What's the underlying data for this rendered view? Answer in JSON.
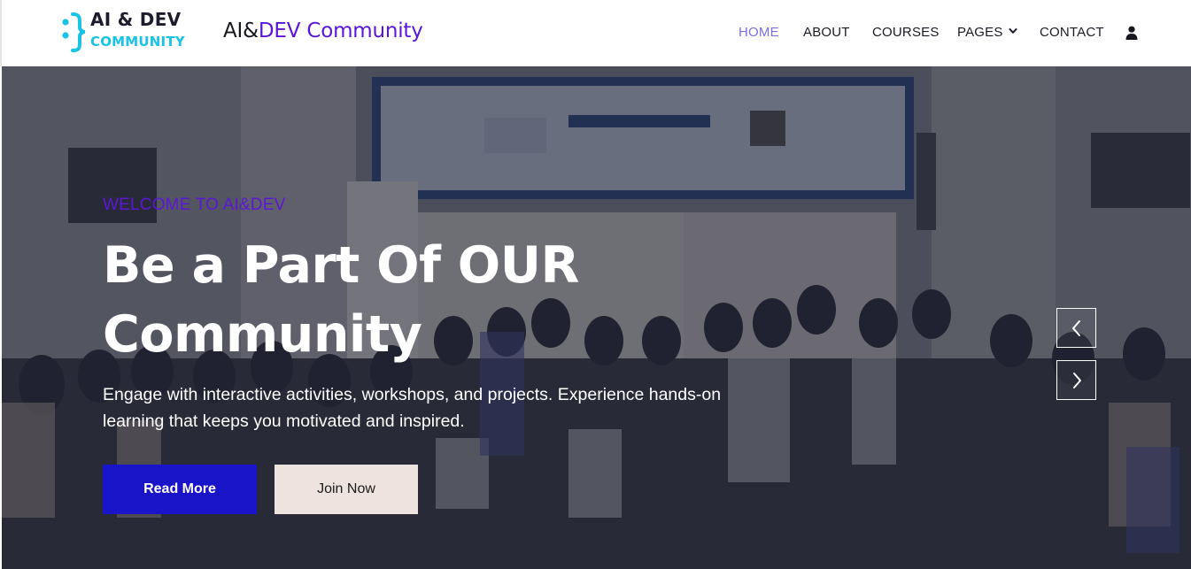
{
  "logo": {
    "line1": "AI & DEV",
    "line2": "COMMUNITY",
    "bracket_color": "#19c3e6"
  },
  "brand": {
    "part1": "AI&",
    "part2": "DEV Community",
    "color_dark": "#16161f",
    "color_accent": "#5b14d9"
  },
  "nav": {
    "items": [
      {
        "label": "HOME",
        "active": true
      },
      {
        "label": "ABOUT",
        "active": false
      },
      {
        "label": "COURSES",
        "active": false
      },
      {
        "label": "PAGES",
        "active": false,
        "has_dropdown": true,
        "icon": "chevron-down-icon"
      },
      {
        "label": "CONTACT",
        "active": false
      }
    ],
    "user_icon": "user-icon",
    "active_color": "#7b6de6"
  },
  "hero": {
    "welcome": "WELCOME TO AI&DEV",
    "headline": "Be a Part Of OUR Community",
    "description": "Engage with interactive activities, workshops, and projects. Experience hands-on learning that keeps you motivated and inspired.",
    "read_more_label": "Read More",
    "join_now_label": "Join Now",
    "prev_icon": "chevron-left-icon",
    "next_icon": "chevron-right-icon",
    "colors": {
      "welcome": "#5c17d6",
      "read_more_bg": "#1a14c9",
      "join_now_bg": "#efe3df"
    }
  }
}
